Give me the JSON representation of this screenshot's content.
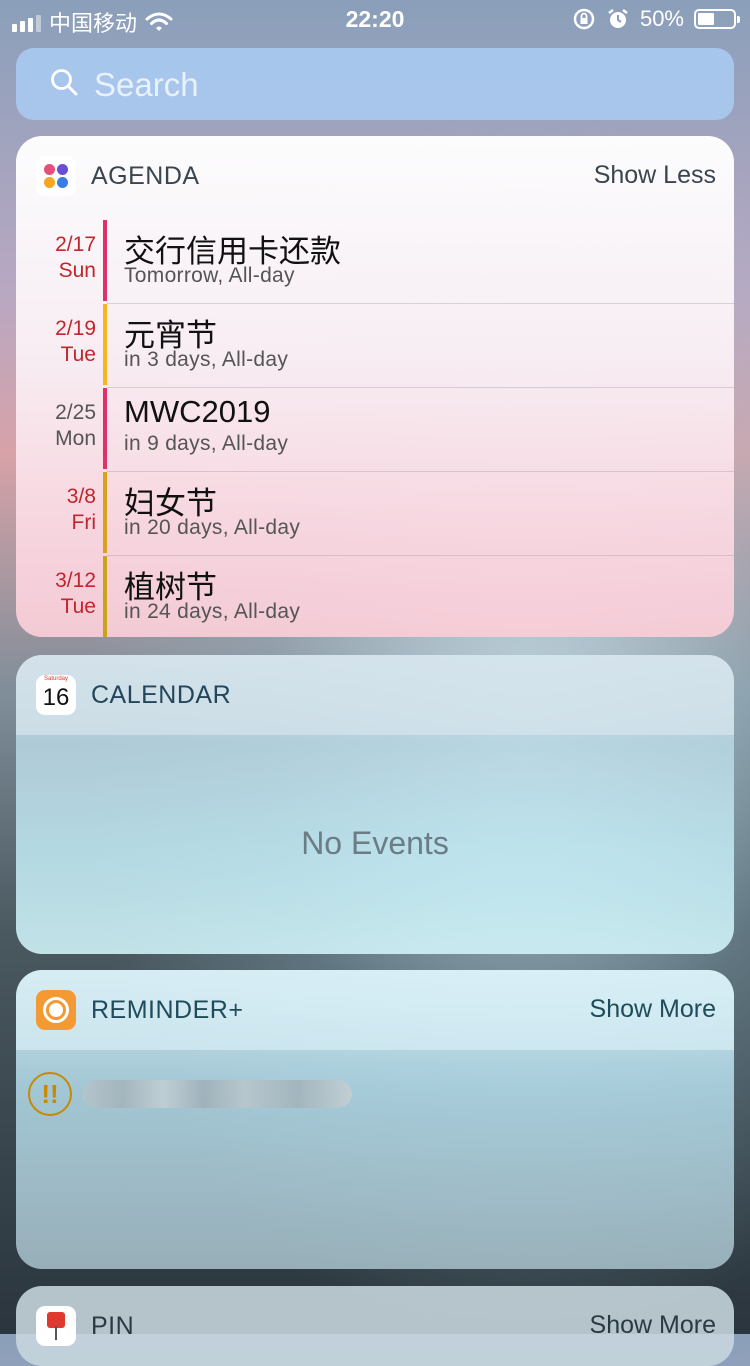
{
  "status_bar": {
    "carrier": "中国移动",
    "time": "22:20",
    "battery": "50%",
    "battery_level": 0.5
  },
  "search": {
    "placeholder": "Search"
  },
  "agenda": {
    "title": "AGENDA",
    "action": "Show Less",
    "events": [
      {
        "date": "2/17",
        "weekday": "Sun",
        "title": "交行信用卡还款",
        "subtitle": "Tomorrow, All-day",
        "date_color": "#c0262b",
        "bar_color": "#e0306a"
      },
      {
        "date": "2/19",
        "weekday": "Tue",
        "title": "元宵节",
        "subtitle": "in 3 days, All-day",
        "date_color": "#c0262b",
        "bar_color": "#f4b81c"
      },
      {
        "date": "2/25",
        "weekday": "Mon",
        "title": "MWC2019",
        "subtitle": "in 9 days, All-day",
        "date_color": "#555555",
        "bar_color": "#e0306a"
      },
      {
        "date": "3/8",
        "weekday": "Fri",
        "title": "妇女节",
        "subtitle": "in 20 days, All-day",
        "date_color": "#c0262b",
        "bar_color": "#d9a21a"
      },
      {
        "date": "3/12",
        "weekday": "Tue",
        "title": "植树节",
        "subtitle": "in 24 days, All-day",
        "date_color": "#c0262b",
        "bar_color": "#c9a318"
      }
    ]
  },
  "calendar": {
    "title": "CALENDAR",
    "icon_day": "Saturday",
    "icon_date": "16",
    "empty_text": "No Events"
  },
  "reminder": {
    "title": "REMINDER+",
    "action": "Show More",
    "priority_mark": "!!"
  },
  "pin": {
    "title": "PIN",
    "action": "Show More"
  },
  "colors": {
    "agenda_dot_1": "#e3507a",
    "agenda_dot_2": "#6a4ed3",
    "agenda_dot_3": "#f5a623",
    "agenda_dot_4": "#3b7de0",
    "reminder_icon": "#f39a35",
    "priority": "#c68a00"
  }
}
